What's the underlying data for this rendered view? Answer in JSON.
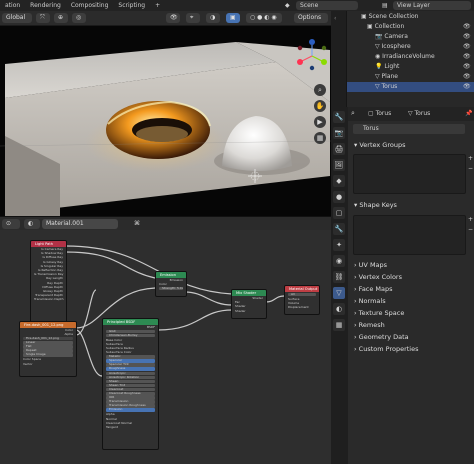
{
  "menu": [
    "ation",
    "Rendering",
    "Compositing",
    "Scripting",
    "+"
  ],
  "scene": "Scene",
  "view_layer": "View Layer",
  "viewport_header": {
    "orientation": "Global",
    "options": "Options"
  },
  "node_editor": {
    "material_name": "Material.001",
    "nodes": {
      "lightpath": {
        "title": "Light Path",
        "rows": [
          "Is Camera Ray",
          "Is Shadow Ray",
          "Is Diffuse Ray",
          "Is Glossy Ray",
          "Is Singular Ray",
          "Is Reflection Ray",
          "Is Transmission Ray",
          "Ray Length",
          "Ray Depth",
          "Diffuse Depth",
          "Glossy Depth",
          "Transparent Depth",
          "Transmission Depth"
        ]
      },
      "emission": {
        "title": "Emission",
        "out": "Emission",
        "rows": [
          "Color",
          "Strength: 5.000"
        ]
      },
      "mixshader": {
        "title": "Mix Shader",
        "out": "Shader",
        "rows": [
          "Fac",
          "Shader",
          "Shader"
        ]
      },
      "output": {
        "title": "Material Output",
        "rows": [
          "All",
          "Surface",
          "Volume",
          "Displacement"
        ]
      },
      "image": {
        "title": "Fire-dash_001_12.png",
        "rows": [
          "Color",
          "Alpha",
          "Linear",
          "Flat",
          "Repeat",
          "Single Image",
          "Color Space",
          "Vector"
        ]
      },
      "principled": {
        "title": "Principled BSDF",
        "out": "BSDF",
        "rows": [
          "GGX",
          "Christensen-Burley",
          "Base Color",
          "Subsurface",
          "Subsurface Radius",
          "Subsurface Color",
          "Metallic",
          "Specular",
          "Specular Tint",
          "Roughness",
          "Anisotropic",
          "Anisotropic Rotation",
          "Sheen",
          "Sheen Tint",
          "Clearcoat",
          "Clearcoat Roughness",
          "IOR",
          "Transmission",
          "Transmission Roughness",
          "Emission",
          "Alpha",
          "Normal",
          "Clearcoat Normal",
          "Tangent"
        ]
      }
    }
  },
  "outliner": {
    "header": "Scene Collection",
    "items": [
      "Collection",
      "Camera",
      "Icosphere",
      "IrradianceVolume",
      "Light",
      "Plane",
      "Torus"
    ]
  },
  "properties": {
    "object": "Torus",
    "mesh": "Torus",
    "data_name": "Torus",
    "vertex_groups": "Vertex Groups",
    "shape_keys": "Shape Keys",
    "sections": [
      "UV Maps",
      "Vertex Colors",
      "Face Maps",
      "Normals",
      "Texture Space",
      "Remesh",
      "Geometry Data",
      "Custom Properties"
    ]
  },
  "colors": {
    "selected": "#334d80",
    "accent_blue": "#4773b3",
    "node_output": "#bf3e44",
    "node_shader": "#2d8a52",
    "node_input": "#b23146",
    "node_texture": "#c76b2c"
  }
}
